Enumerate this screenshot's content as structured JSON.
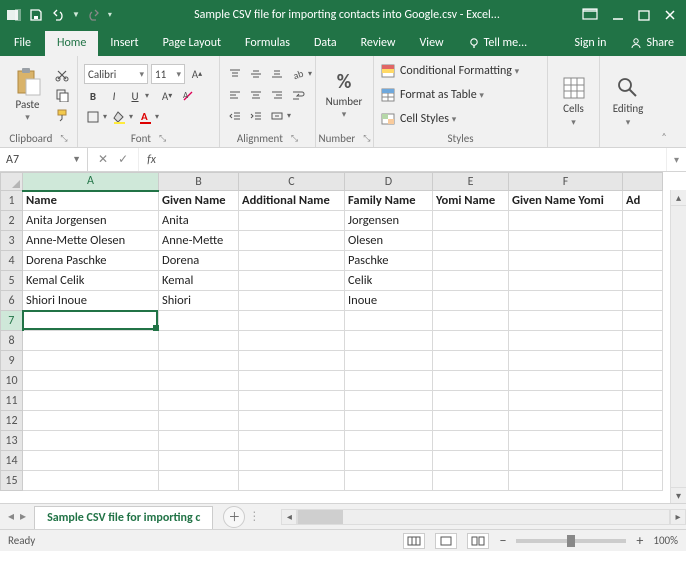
{
  "titlebar": {
    "title": "Sample CSV file for importing contacts into Google.csv - Excel..."
  },
  "tabs": {
    "file": "File",
    "home": "Home",
    "insert": "Insert",
    "pagelayout": "Page Layout",
    "formulas": "Formulas",
    "data": "Data",
    "review": "Review",
    "view": "View",
    "tellme": "Tell me...",
    "signin": "Sign in",
    "share": "Share"
  },
  "ribbon": {
    "clipboard": {
      "paste": "Paste",
      "label": "Clipboard"
    },
    "font": {
      "name": "Calibri",
      "size": "11",
      "bold": "B",
      "italic": "I",
      "underline": "U",
      "label": "Font"
    },
    "alignment": {
      "label": "Alignment"
    },
    "number": {
      "btn": "Number",
      "pct": "%",
      "label": "Number"
    },
    "styles": {
      "cond": "Conditional Formatting",
      "table": "Format as Table",
      "cell": "Cell Styles",
      "label": "Styles"
    },
    "cells": {
      "btn": "Cells",
      "label": ""
    },
    "editing": {
      "btn": "Editing",
      "label": ""
    }
  },
  "fbar": {
    "namebox": "A7",
    "fx": "fx",
    "formula": ""
  },
  "sheet": {
    "cols": [
      "A",
      "B",
      "C",
      "D",
      "E",
      "F",
      "Ad"
    ],
    "headerPartial": "Ad",
    "rows": [
      {
        "n": "1",
        "cells": [
          "Name",
          "Given Name",
          "Additional Name",
          "Family Name",
          "Yomi Name",
          "Given Name Yomi",
          ""
        ],
        "bold": true
      },
      {
        "n": "2",
        "cells": [
          "Anita Jorgensen",
          "Anita",
          "",
          "Jorgensen",
          "",
          "",
          ""
        ]
      },
      {
        "n": "3",
        "cells": [
          "Anne-Mette Olesen",
          "Anne-Mette",
          "",
          "Olesen",
          "",
          "",
          ""
        ]
      },
      {
        "n": "4",
        "cells": [
          "Dorena Paschke",
          "Dorena",
          "",
          "Paschke",
          "",
          "",
          ""
        ]
      },
      {
        "n": "5",
        "cells": [
          "Kemal Celik",
          "Kemal",
          "",
          "Celik",
          "",
          "",
          ""
        ]
      },
      {
        "n": "6",
        "cells": [
          "Shiori Inoue",
          "Shiori",
          "",
          "Inoue",
          "",
          "",
          ""
        ]
      },
      {
        "n": "7",
        "cells": [
          "",
          "",
          "",
          "",
          "",
          "",
          ""
        ]
      },
      {
        "n": "8",
        "cells": [
          "",
          "",
          "",
          "",
          "",
          "",
          ""
        ]
      },
      {
        "n": "9",
        "cells": [
          "",
          "",
          "",
          "",
          "",
          "",
          ""
        ]
      },
      {
        "n": "10",
        "cells": [
          "",
          "",
          "",
          "",
          "",
          "",
          ""
        ]
      },
      {
        "n": "11",
        "cells": [
          "",
          "",
          "",
          "",
          "",
          "",
          ""
        ]
      },
      {
        "n": "12",
        "cells": [
          "",
          "",
          "",
          "",
          "",
          "",
          ""
        ]
      },
      {
        "n": "13",
        "cells": [
          "",
          "",
          "",
          "",
          "",
          "",
          ""
        ]
      },
      {
        "n": "14",
        "cells": [
          "",
          "",
          "",
          "",
          "",
          "",
          ""
        ]
      },
      {
        "n": "15",
        "cells": [
          "",
          "",
          "",
          "",
          "",
          "",
          ""
        ]
      }
    ],
    "activeRow": 7,
    "activeCol": 0
  },
  "sheettab": {
    "name": "Sample CSV file for importing c"
  },
  "status": {
    "ready": "Ready",
    "zoom": "100%"
  }
}
